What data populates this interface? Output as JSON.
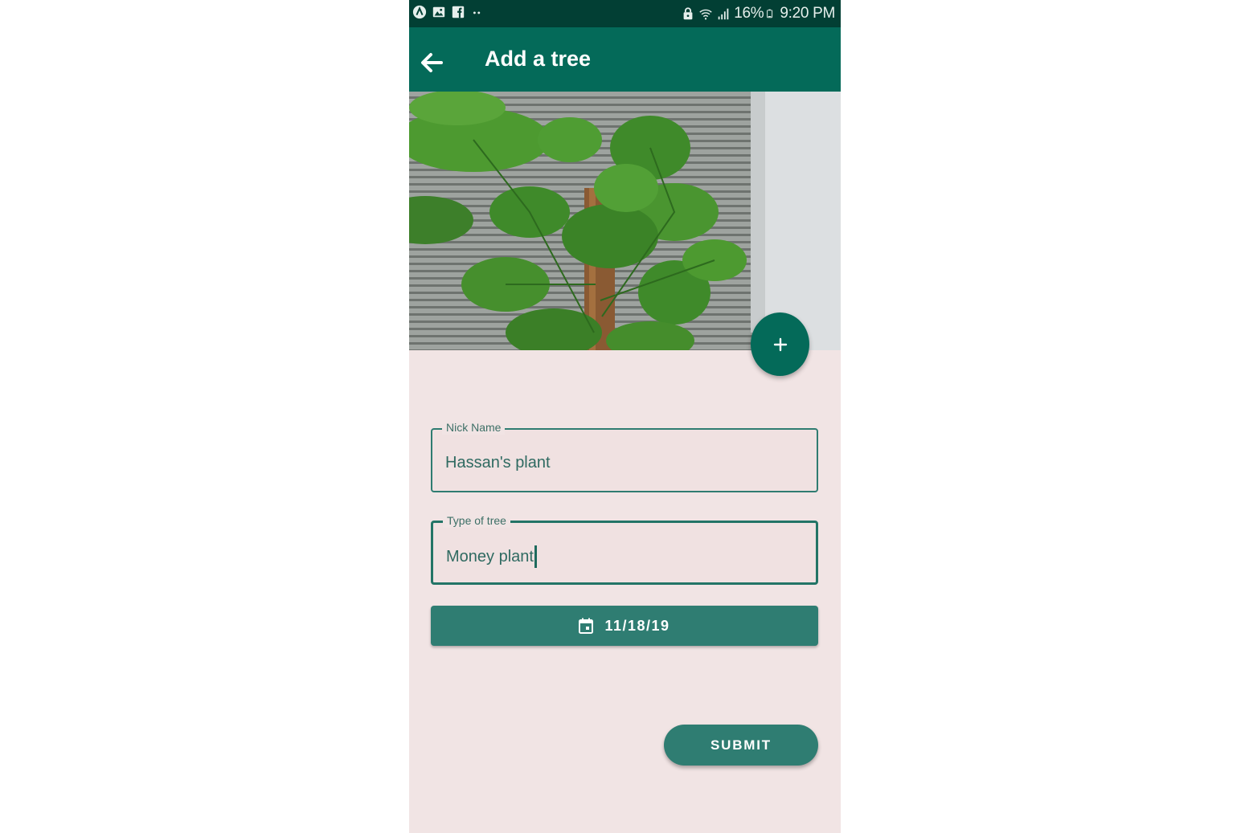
{
  "status_bar": {
    "left_icons": [
      "app-icon",
      "image-icon",
      "facebook-icon",
      "more-dots-icon"
    ],
    "right_icons": [
      "lock-icon",
      "wifi-icon",
      "signal-icon",
      "battery-icon"
    ],
    "battery": "16%",
    "time": "9:20 PM"
  },
  "app_bar": {
    "title": "Add a tree",
    "back_icon": "arrow-back-icon"
  },
  "photo": {
    "description_icon": "plant-photo"
  },
  "fab": {
    "icon": "plus-icon"
  },
  "form": {
    "nick_name": {
      "label": "Nick Name",
      "value": "Hassan's plant"
    },
    "type_of_tree": {
      "label": "Type of tree",
      "value": "Money plant"
    },
    "date_button": {
      "icon": "calendar-icon",
      "label": "11/18/19"
    },
    "submit_label": "SUBMIT"
  },
  "colors": {
    "status_bar": "#023f34",
    "app_bar": "#046a59",
    "accent": "#2f7d72",
    "background": "#f1e4e4"
  }
}
